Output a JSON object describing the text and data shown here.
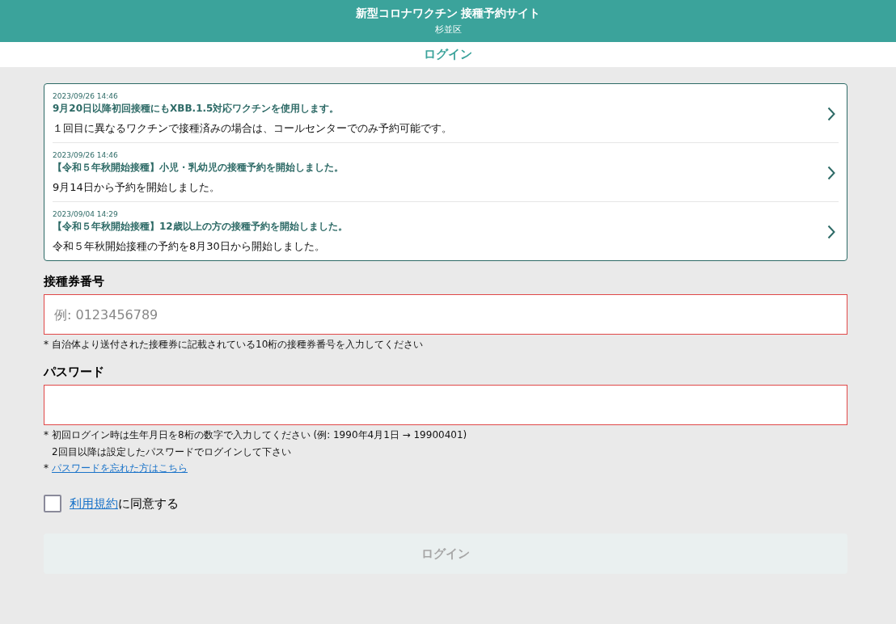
{
  "header": {
    "title": "新型コロナワクチン 接種予約サイト",
    "subtitle": "杉並区"
  },
  "page_title": "ログイン",
  "notices": [
    {
      "date": "2023/09/26 14:46",
      "title": "9月20日以降初回接種にもXBB.1.5対応ワクチンを使用します。",
      "body": "１回目に異なるワクチンで接種済みの場合は、コールセンターでのみ予約可能です。"
    },
    {
      "date": "2023/09/26 14:46",
      "title": "【令和５年秋開始接種】小児・乳幼児の接種予約を開始しました。",
      "body": "9月14日から予約を開始しました。"
    },
    {
      "date": "2023/09/04 14:29",
      "title": "【令和５年秋開始接種】12歳以上の方の接種予約を開始しました。",
      "body": "令和５年秋開始接種の予約を8月30日から開始しました。"
    }
  ],
  "fields": [
    {
      "label": "接種券番号",
      "placeholder": "例: 0123456789",
      "invalid": true,
      "hints": [
        {
          "mark": "*",
          "text": "自治体より送付された接種券に記載されている10桁の接種券番号を入力してください"
        }
      ]
    },
    {
      "label": "パスワード",
      "invalid": true,
      "hints": [
        {
          "mark": "*",
          "text": "初回ログイン時は生年月日を8桁の数字で入力してください (例: 1990年4月1日 → 19900401)"
        },
        {
          "text": "2回目以降は設定したパスワードでログインして下さい"
        },
        {
          "mark": "*",
          "link": "パスワードを忘れた方はこちら"
        }
      ]
    }
  ],
  "terms": {
    "checked": false,
    "link": "利用規約",
    "text": "に同意する"
  },
  "login_button": {
    "label": "ログイン",
    "disabled": true
  }
}
